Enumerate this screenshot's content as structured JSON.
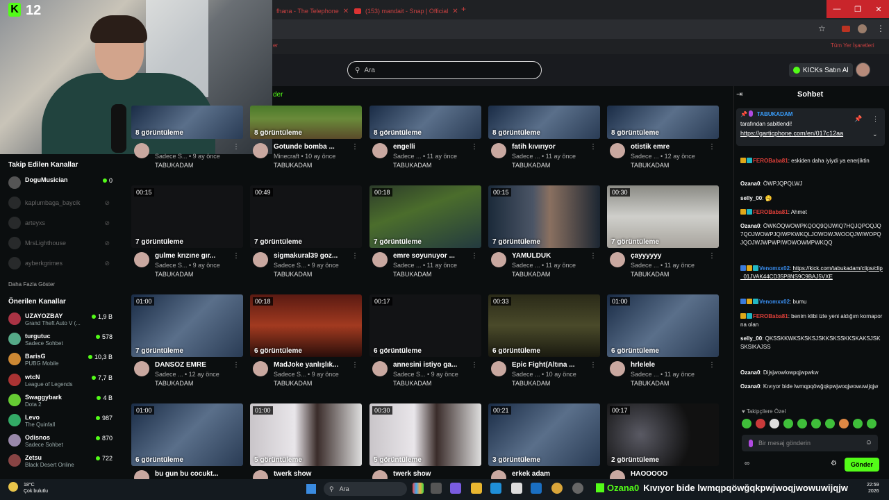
{
  "browser": {
    "tabs": [
      {
        "title": "fhana - The Telephone"
      },
      {
        "title": "(153) mandait - Snap | Official"
      }
    ],
    "bookmarks_all": "Tüm Yer İşaretleri"
  },
  "header": {
    "search_placeholder": "Ara",
    "buy_label": "KICKs Satın Al",
    "section_link": "der"
  },
  "stream_overlay": {
    "logo": "K",
    "viewer_count": "12"
  },
  "sidebar": {
    "followed_title": "Takip Edilen Kanallar",
    "followed": [
      {
        "name": "DoguMusician",
        "viewers": "0",
        "live": true
      },
      {
        "name": "kaplumbaga_baycik",
        "live": false
      },
      {
        "name": "arteyxs",
        "live": false
      },
      {
        "name": "MrsLighthouse",
        "live": false
      },
      {
        "name": "ayberkgrimes",
        "live": false
      }
    ],
    "show_more": "Daha Fazla Göster",
    "recommended_title": "Önerilen Kanallar",
    "recommended": [
      {
        "name": "UZAYOZBAY",
        "category": "Grand Theft Auto V (...",
        "viewers": "1,9 B"
      },
      {
        "name": "turgutuc",
        "category": "Sadece Sohbet",
        "viewers": "578"
      },
      {
        "name": "BarisG",
        "category": "PUBG Mobile",
        "viewers": "10,3 B"
      },
      {
        "name": "wtcN",
        "category": "League of Legends",
        "viewers": "7,7 B"
      },
      {
        "name": "Swaggybark",
        "category": "Dota 2",
        "viewers": "4 B"
      },
      {
        "name": "Levo",
        "category": "The Quinfall",
        "viewers": "987"
      },
      {
        "name": "Odisnos",
        "category": "Sadece Sohbet",
        "viewers": "870"
      },
      {
        "name": "Zetsu",
        "category": "Black Desert Online",
        "viewers": "722"
      }
    ]
  },
  "clips": [
    {
      "title": "",
      "views": "8 görüntüleme",
      "duration": "",
      "sub": "Sadece S... • 9 ay önce",
      "channel": "TABUKADAM"
    },
    {
      "title": "Gotunde bomba ...",
      "views": "8 görüntüleme",
      "duration": "",
      "sub": "Minecraft • 10 ay önce",
      "channel": "TABUKADAM"
    },
    {
      "title": "engelli",
      "views": "8 görüntüleme",
      "duration": "",
      "sub": "Sadece ... • 11 ay önce",
      "channel": "TABUKADAM"
    },
    {
      "title": "fatih kıvırıyor",
      "views": "8 görüntüleme",
      "duration": "",
      "sub": "Sadece ... • 11 ay önce",
      "channel": "TABUKADAM"
    },
    {
      "title": "otistik emre",
      "views": "8 görüntüleme",
      "duration": "",
      "sub": "Sadece ... • 12 ay önce",
      "channel": "TABUKADAM"
    },
    {
      "title": "gulme krızıne gır...",
      "views": "7 görüntüleme",
      "duration": "00:15",
      "sub": "Sadece S... • 9 ay önce",
      "channel": "TABUKADAM"
    },
    {
      "title": "sigmakural39 goz...",
      "views": "7 görüntüleme",
      "duration": "00:49",
      "sub": "Sadece S... • 9 ay önce",
      "channel": "TABUKADAM"
    },
    {
      "title": "emre soyunuyor ...",
      "views": "7 görüntüleme",
      "duration": "00:18",
      "sub": "Sadece ... • 11 ay önce",
      "channel": "TABUKADAM"
    },
    {
      "title": "YAMULDUK",
      "views": "7 görüntüleme",
      "duration": "00:15",
      "sub": "Sadece ... • 11 ay önce",
      "channel": "TABUKADAM"
    },
    {
      "title": "çayyyyyy",
      "views": "7 görüntüleme",
      "duration": "00:30",
      "sub": "Sadece ... • 11 ay önce",
      "channel": "TABUKADAM"
    },
    {
      "title": "DANSÖZ EMRE",
      "views": "7 görüntüleme",
      "duration": "01:00",
      "sub": "Sadece ... • 12 ay önce",
      "channel": "TABUKADAM"
    },
    {
      "title": "MadJoke yanlışlık...",
      "views": "6 görüntüleme",
      "duration": "00:18",
      "sub": "Sadece S... • 9 ay önce",
      "channel": "TABUKADAM"
    },
    {
      "title": "annesini istiyo ga...",
      "views": "6 görüntüleme",
      "duration": "00:17",
      "sub": "Sadece S... • 9 ay önce",
      "channel": "TABUKADAM"
    },
    {
      "title": "Epic Fight(Altına ...",
      "views": "6 görüntüleme",
      "duration": "00:33",
      "sub": "Sadece ... • 10 ay önce",
      "channel": "TABUKADAM"
    },
    {
      "title": "hrlelele",
      "views": "6 görüntüleme",
      "duration": "01:00",
      "sub": "Sadece ... • 11 ay önce",
      "channel": "TABUKADAM"
    },
    {
      "title": "bu gun bu cocukt...",
      "views": "6 görüntüleme",
      "duration": "01:00",
      "sub": "",
      "channel": ""
    },
    {
      "title": "twerk show",
      "views": "5 görüntüleme",
      "duration": "01:00",
      "sub": "",
      "channel": ""
    },
    {
      "title": "twerk show",
      "views": "5 görüntüleme",
      "duration": "00:30",
      "sub": "",
      "channel": ""
    },
    {
      "title": "erkek adam",
      "views": "3 görüntüleme",
      "duration": "00:21",
      "sub": "",
      "channel": ""
    },
    {
      "title": "HAOOOOO",
      "views": "2 görüntüleme",
      "duration": "00:17",
      "sub": "",
      "channel": ""
    }
  ],
  "chat": {
    "title": "Sohbet",
    "pinned": {
      "user": "TABUKADAM",
      "text": "tarafından sabitlendi!",
      "link": "https://garticphone.com/en/017c12aa"
    },
    "messages": [
      {
        "user": "FEROBaba81",
        "text": "eskiden daha iyiydi ya enerjiktin"
      },
      {
        "user": "Ozana0",
        "text": "ÖWPJQPQLWJ"
      },
      {
        "user": "selly_00",
        "text": "🥱"
      },
      {
        "user": "FEROBaba81",
        "text": "Ahmet"
      },
      {
        "user": "Ozana0",
        "text": "ÖWKÖQWOWPKQOQ9QIJWIQ7HQJQPOQJQ7QOJWOWPJQIWPKWKQLJOWOWJWOOQJWIWOPQJQOJWJWPWPIWOWOWMPWKQQ"
      },
      {
        "user": "Venomxx02",
        "text": "https://kick.com/tabukadam/clips/clip_01JVAK44CD35P8NS9C9BAJ5VXE"
      },
      {
        "user": "Venomxx02",
        "text": "bumu"
      },
      {
        "user": "FEROBaba81",
        "text": "benim klibi izle yeni aldığım kornaporna olan"
      },
      {
        "user": "selly_00",
        "text": "QKSSKKWKSKSKSJSKKSKSSKKSKAKSJSKSKSIKAJSS"
      },
      {
        "user": "Ozana0",
        "text": "Dijsjwowlowpqjwpwkw"
      },
      {
        "user": "Ozana0",
        "text": "Kıvıyor bide lwmqpqöwğqkpwjwoqjwowuwijqjw"
      }
    ],
    "followers_only": "Takipçilere Özel",
    "input_placeholder": "Bir mesaj gönderin",
    "send_label": "Gönder"
  },
  "taskbar": {
    "temp": "18°C",
    "weather": "Çok bulutlu",
    "search": "Ara",
    "ticker_user": "Ozana0",
    "ticker_text": "Kıvıyor bide lwmqpqöwğqkpwjwoqjwowuwijqjw",
    "time": "22:59",
    "date": "2026"
  }
}
